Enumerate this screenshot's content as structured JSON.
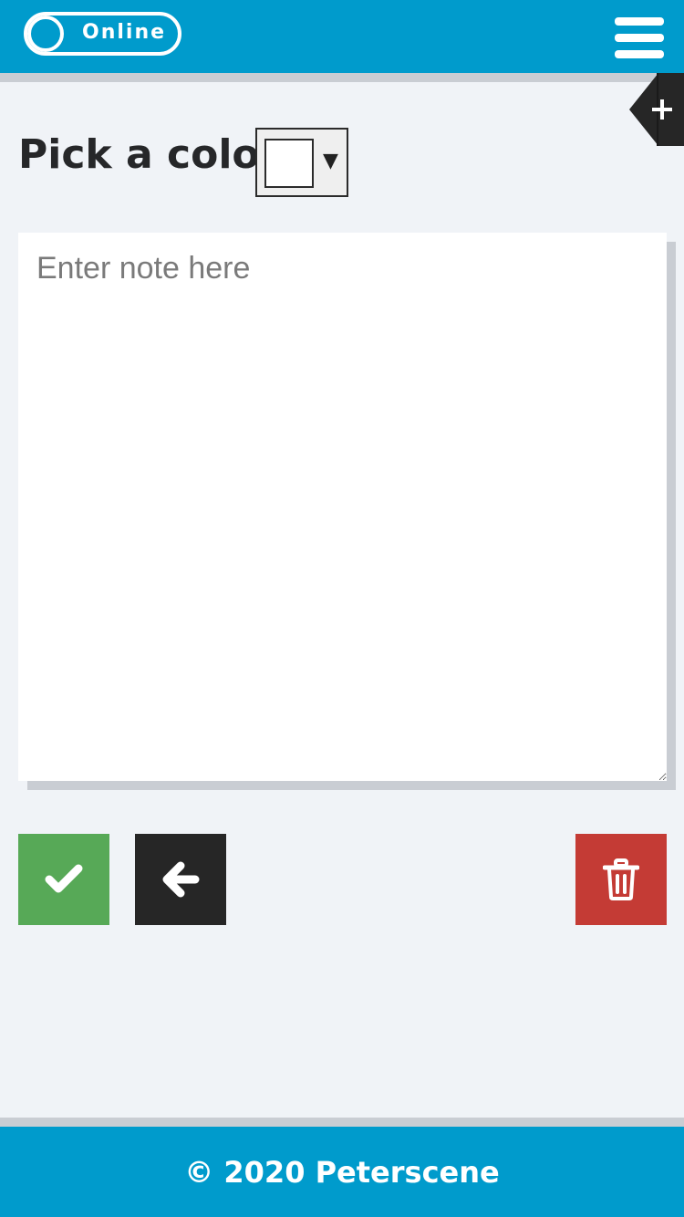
{
  "header": {
    "status_toggle": {
      "label": "Online",
      "state": "on"
    },
    "menu_icon": "hamburger-menu-icon"
  },
  "add_tab": {
    "icon": "plus-icon"
  },
  "color_picker": {
    "label": "Pick a color",
    "selected_color": "#ffffff",
    "caret_glyph": "▼"
  },
  "note": {
    "placeholder": "Enter note here",
    "value": ""
  },
  "actions": {
    "save": {
      "icon": "checkmark-icon",
      "color": "#57a957"
    },
    "back": {
      "icon": "arrow-left-icon",
      "color": "#262626"
    },
    "delete": {
      "icon": "trash-icon",
      "color": "#c43b35"
    }
  },
  "footer": {
    "text": "© 2020 Peterscene"
  },
  "colors": {
    "brand": "#009bcc",
    "background": "#f0f3f7",
    "shadow": "#c9cdd3"
  }
}
